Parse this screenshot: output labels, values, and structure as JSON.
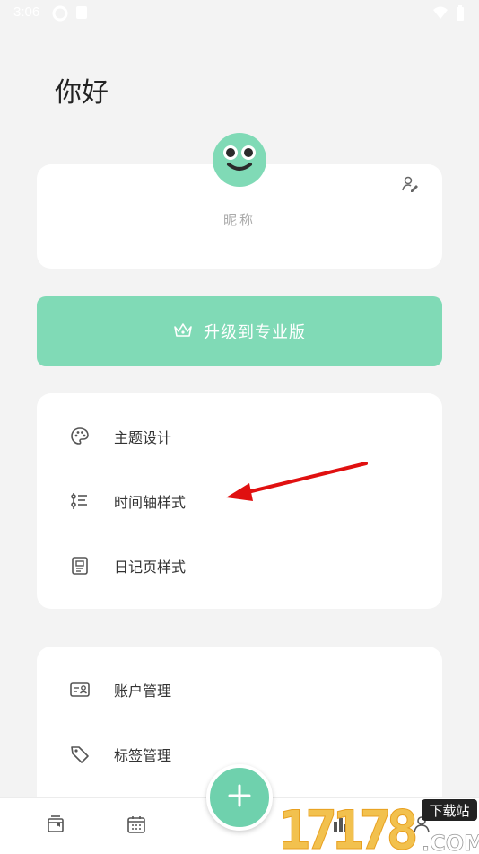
{
  "status_bar": {
    "time": "3:06"
  },
  "greeting": "你好",
  "profile": {
    "nickname": "昵称"
  },
  "upgrade": {
    "label": "升级到专业版"
  },
  "menu_group_1": [
    {
      "label": "主题设计",
      "icon": "palette-icon"
    },
    {
      "label": "时间轴样式",
      "icon": "timeline-style-icon"
    },
    {
      "label": "日记页样式",
      "icon": "diary-page-icon"
    }
  ],
  "menu_group_2": [
    {
      "label": "账户管理",
      "icon": "account-card-icon"
    },
    {
      "label": "标签管理",
      "icon": "tag-icon"
    }
  ],
  "watermark": {
    "text": "17178",
    "badge": "下载站",
    "suffix": ".COM"
  },
  "colors": {
    "accent": "#80dab6",
    "fab": "#6fd1ad",
    "background": "#f3f3f3",
    "arrow": "#e01010"
  }
}
